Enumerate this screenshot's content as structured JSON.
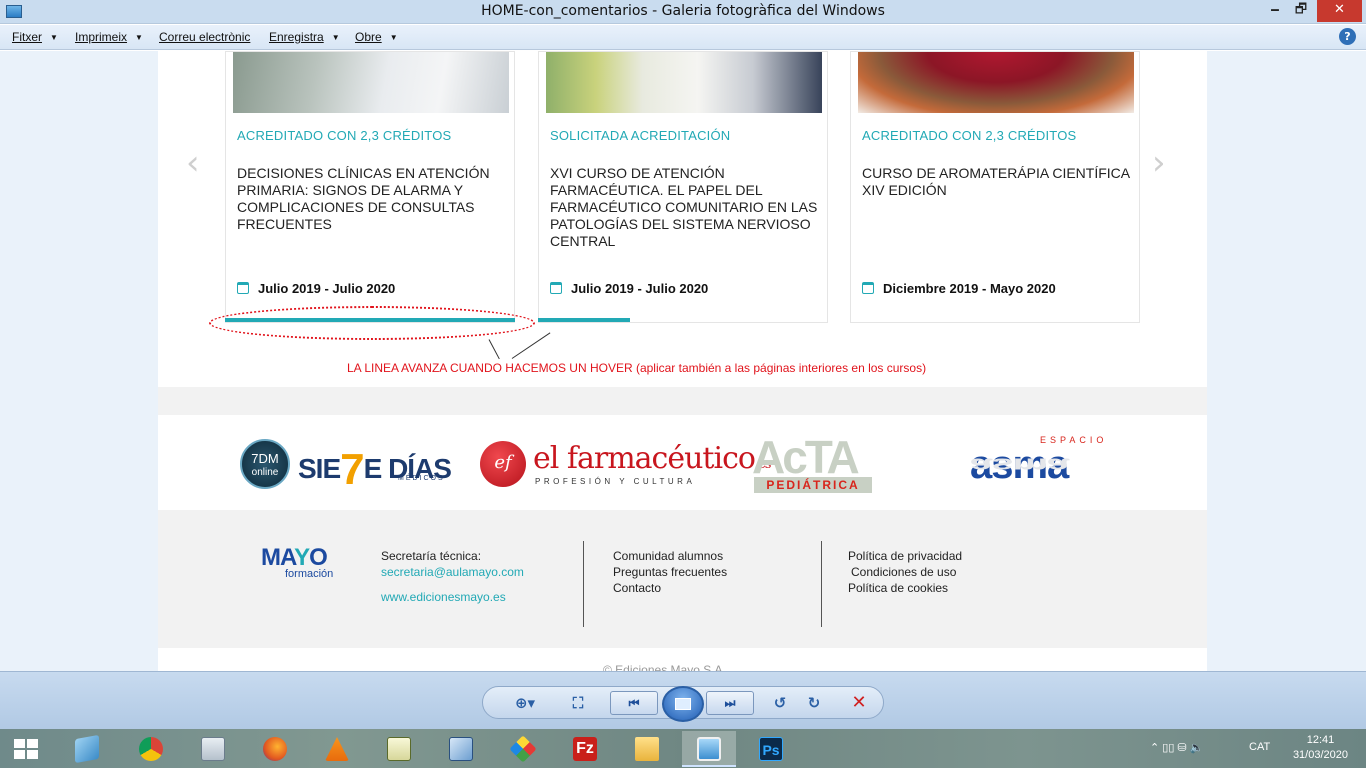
{
  "window": {
    "title": "HOME-con_comentarios - Galeria fotogràfica del Windows",
    "minimize": "🗕",
    "maximize": "🗗",
    "close": "✕"
  },
  "menubar": {
    "items": [
      "Fitxer",
      "Imprimeix",
      "Correu electrònic",
      "Enregistra",
      "Obre"
    ],
    "help": "?"
  },
  "carousel": {
    "prev": "‹",
    "next": "›",
    "cards": [
      {
        "status": "ACREDITADO CON 2,3 CRÉDITOS",
        "title": "DECISIONES CLÍNICAS EN ATENCIÓN PRIMARIA: SIGNOS DE ALARMA Y COMPLICACIONES DE CONSULTAS FRECUENTES",
        "dates": "Julio 2019 - Julio 2020"
      },
      {
        "status": "SOLICITADA ACREDITACIÓN",
        "title": "XVI CURSO DE ATENCIÓN FARMACÉUTICA. EL PAPEL DEL FARMACÉUTICO COMUNITARIO EN LAS PATOLOGÍAS DEL SISTEMA NERVIOSO CENTRAL",
        "dates": "Julio 2019 - Julio 2020"
      },
      {
        "status": "ACREDITADO CON 2,3 CRÉDITOS",
        "title": "CURSO DE AROMATERÁPIA CIENTÍFICA XIV EDICIÓN",
        "dates": "Diciembre 2019 - Mayo 2020"
      }
    ],
    "annotation": "LA LINEA AVANZA CUANDO HACEMOS UN HOVER (aplicar también a las páginas interiores en los cursos)"
  },
  "logos": {
    "sietedias_badge_top": "7DM",
    "sietedias_badge_bottom": "online",
    "sietedias_left": "SIE",
    "sietedias_seven": "7",
    "sietedias_right": "E DÍAS",
    "sietedias_sub": "MÉDICOS",
    "ef_badge": "ef",
    "ef_name": "el farmacéutico",
    "ef_tld": ".es",
    "ef_sub": "PROFESIÓN Y CULTURA",
    "acta": "AcTA",
    "acta_sub": "PEDIÁTRICA",
    "asma_top": "ESPACIO",
    "asma": "asma"
  },
  "footer": {
    "brand_main_a": "MA",
    "brand_main_b": "Y",
    "brand_main_c": "O",
    "brand_sub": "formación",
    "secretaria_label": "Secretaría técnica:",
    "secretaria_email": "secretaria@aulamayo.com",
    "website": "www.edicionesmayo.es",
    "col2": [
      "Comunidad alumnos",
      "Preguntas frecuentes",
      "Contacto"
    ],
    "col3": [
      "Política de privacidad",
      "Condiciones de uso",
      "Política de cookies"
    ],
    "copyright": "© Ediciones Mayo S.A."
  },
  "viewer_toolbar": {
    "zoom": "⊕▾",
    "fit": "⛶",
    "prev": "⏮",
    "next": "⏭",
    "rotate_left": "↺",
    "rotate_right": "↻",
    "delete": "✕"
  },
  "taskbar": {
    "language": "CAT",
    "time": "12:41",
    "date": "31/03/2020",
    "tray_icons": "⌃  ▯▯  ⛁  🔈"
  }
}
